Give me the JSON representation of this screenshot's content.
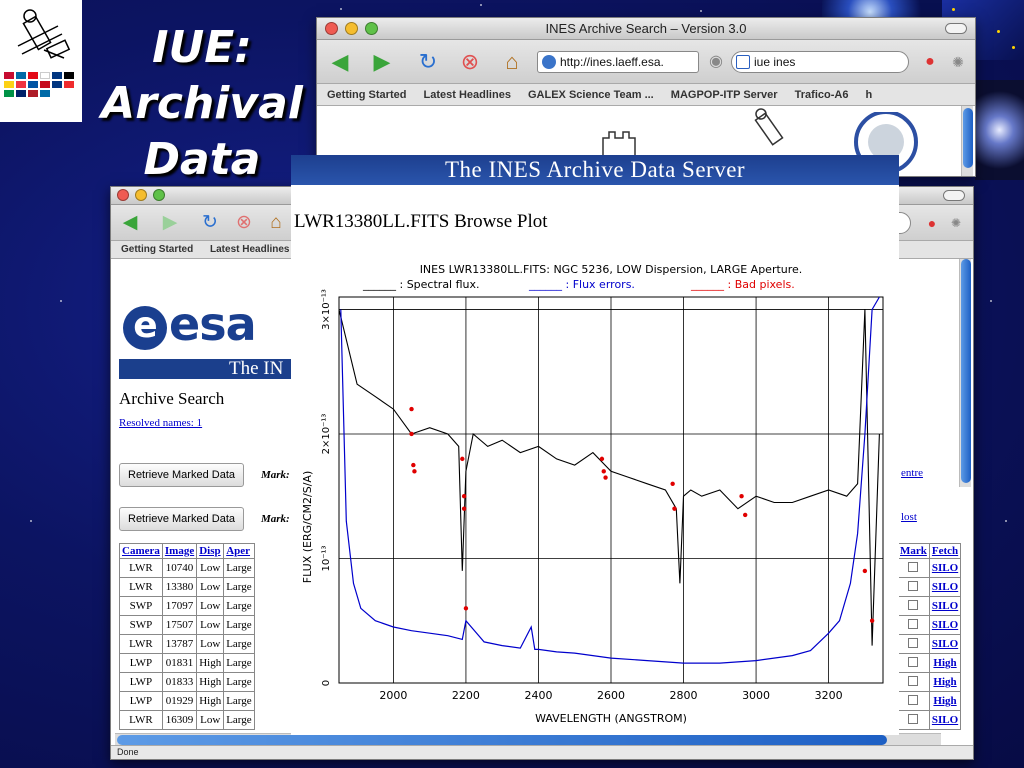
{
  "slide": {
    "title_lines": [
      "IUE:",
      "Archival",
      "Data"
    ]
  },
  "back_window": {
    "title": "INES Archive Search – Version 3.0",
    "url": "http://ines.laeff.esa.",
    "search_value": "iue ines",
    "bookmarks": [
      "Getting Started",
      "Latest Headlines",
      "GALEX Science Team ...",
      "MAGPOP-ITP Server",
      "Trafico-A6",
      "h"
    ]
  },
  "mid_window": {
    "bookmarks": [
      "Getting Started",
      "Latest Headlines"
    ],
    "logo_text": "esa",
    "ines_band": "The  IN",
    "archive_heading": "Archive Search",
    "resolved_link": "Resolved names: 1",
    "retrieve_label": "Retrieve Marked Data",
    "mark_label": "Mark:",
    "centre_link": "entre",
    "lost_link": "lost",
    "status": "Done",
    "table": {
      "headers": [
        "Camera",
        "Image",
        "Disp",
        "Aper"
      ],
      "rows": [
        [
          "LWR",
          "10740",
          "Low",
          "Large"
        ],
        [
          "LWR",
          "13380",
          "Low",
          "Large"
        ],
        [
          "SWP",
          "17097",
          "Low",
          "Large"
        ],
        [
          "SWP",
          "17507",
          "Low",
          "Large"
        ],
        [
          "LWR",
          "13787",
          "Low",
          "Large"
        ],
        [
          "LWP",
          "01831",
          "High",
          "Large"
        ],
        [
          "LWP",
          "01833",
          "High",
          "Large"
        ],
        [
          "LWP",
          "01929",
          "High",
          "Large"
        ],
        [
          "LWR",
          "16309",
          "Low",
          "Large"
        ]
      ]
    },
    "right_table": {
      "headers": [
        "Mark",
        "Fetch"
      ],
      "fetch": [
        "SILO",
        "SILO",
        "SILO",
        "SILO",
        "SILO",
        "High",
        "High",
        "High",
        "SILO"
      ]
    }
  },
  "plot_panel": {
    "header": "The  INES  Archive  Data  Server",
    "title": "LWR13380LL.FITS Browse Plot"
  },
  "chart_data": {
    "type": "line",
    "title": "INES LWR13380LL.FITS: NGC 5236, LOW Dispersion, LARGE Aperture.",
    "legend": [
      {
        "label": "______ : Spectral flux.",
        "color": "#000000"
      },
      {
        "label": "______ : Flux errors.",
        "color": "#0000cc"
      },
      {
        "label": "______ : Bad pixels.",
        "color": "#e00000"
      }
    ],
    "xlabel": "WAVELENGTH (ANGSTROM)",
    "ylabel": "FLUX (ERG/CM2/S/A)",
    "xlim": [
      1850,
      3350
    ],
    "ylim": [
      0,
      3.1e-13
    ],
    "xticks": [
      2000,
      2200,
      2400,
      2600,
      2800,
      3000,
      3200
    ],
    "yticks": [
      {
        "value": 0,
        "label": "0"
      },
      {
        "value": 1e-13,
        "label": "10⁻¹³"
      },
      {
        "value": 2e-13,
        "label": "2×10⁻¹³"
      },
      {
        "value": 3e-13,
        "label": "3×10⁻¹³"
      }
    ],
    "grid": true,
    "series": [
      {
        "color": "#000000",
        "x": [
          1850,
          1900,
          1950,
          2000,
          2050,
          2100,
          2150,
          2180,
          2190,
          2200,
          2220,
          2260,
          2300,
          2350,
          2400,
          2450,
          2500,
          2550,
          2600,
          2650,
          2700,
          2750,
          2780,
          2790,
          2800,
          2820,
          2850,
          2900,
          2950,
          3000,
          3050,
          3100,
          3150,
          3200,
          3250,
          3280,
          3300,
          3320,
          3340
        ],
        "y": [
          3e-13,
          2.4e-13,
          2.3e-13,
          2.2e-13,
          2e-13,
          2.05e-13,
          2e-13,
          1.9e-13,
          9e-14,
          1.7e-13,
          2e-13,
          1.9e-13,
          1.95e-13,
          1.85e-13,
          1.9e-13,
          1.8e-13,
          1.75e-13,
          1.85e-13,
          1.7e-13,
          1.65e-13,
          1.6e-13,
          1.55e-13,
          1.4e-13,
          8e-14,
          1.5e-13,
          1.55e-13,
          1.5e-13,
          1.55e-13,
          1.4e-13,
          1.5e-13,
          1.45e-13,
          1.45e-13,
          1.5e-13,
          1.55e-13,
          1.5e-13,
          1.6e-13,
          3e-13,
          3e-14,
          2e-13
        ]
      },
      {
        "color": "#0000cc",
        "x": [
          1855,
          1870,
          1890,
          1910,
          1950,
          2000,
          2050,
          2100,
          2150,
          2190,
          2200,
          2250,
          2300,
          2350,
          2380,
          2390,
          2400,
          2450,
          2500,
          2550,
          2600,
          2700,
          2800,
          2900,
          3000,
          3100,
          3150,
          3200,
          3230,
          3260,
          3280,
          3300,
          3320,
          3340
        ],
        "y": [
          3e-13,
          1.3e-13,
          8e-14,
          6e-14,
          5e-14,
          4.5e-14,
          4.2e-14,
          4e-14,
          3.8e-14,
          3.5e-14,
          5e-14,
          3.3e-14,
          3e-14,
          2.8e-14,
          4.5e-14,
          2.7e-14,
          2.7e-14,
          2.5e-14,
          2.4e-14,
          2.2e-14,
          2e-14,
          1.8e-14,
          1.6e-14,
          1.6e-14,
          1.8e-14,
          2.2e-14,
          2.6e-14,
          4e-14,
          5e-14,
          8e-14,
          1.2e-13,
          2e-13,
          3e-13,
          3.1e-13
        ]
      }
    ],
    "bad_pixels": {
      "x": [
        2050,
        2050,
        2055,
        2058,
        2190,
        2195,
        2200,
        2195,
        2575,
        2580,
        2585,
        2770,
        2775,
        2960,
        2970,
        3300,
        3320
      ],
      "y": [
        2.2e-13,
        2e-13,
        1.75e-13,
        1.7e-13,
        1.8e-13,
        1.5e-13,
        6e-14,
        1.4e-13,
        1.8e-13,
        1.7e-13,
        1.65e-13,
        1.6e-13,
        1.4e-13,
        1.5e-13,
        1.35e-13,
        9e-14,
        5e-14
      ]
    }
  }
}
